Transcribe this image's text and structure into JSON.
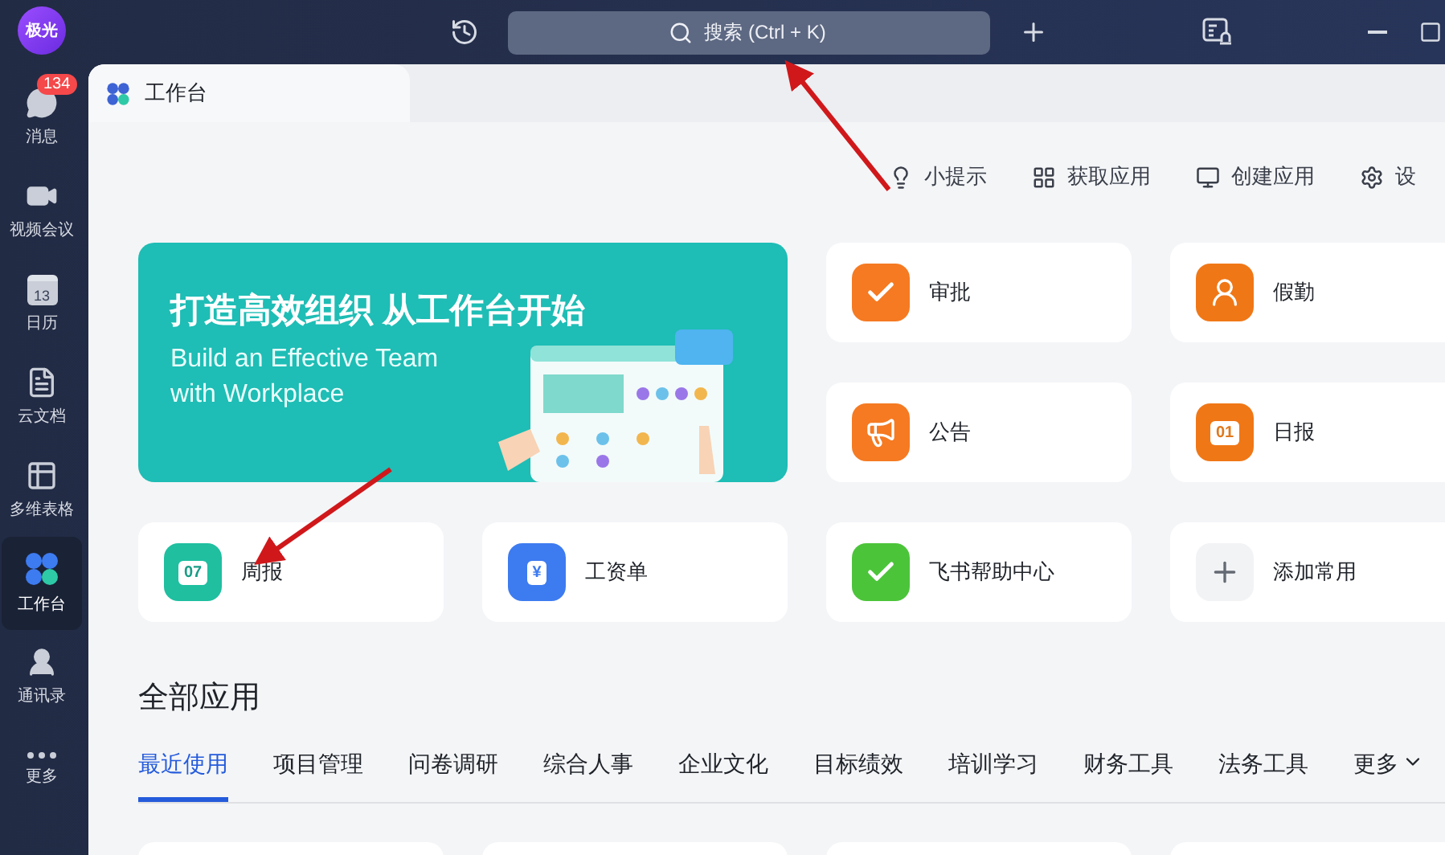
{
  "app": {
    "avatar": "极光"
  },
  "sidebar": {
    "items": [
      {
        "kind": "chat",
        "label": "消息",
        "badge": "134",
        "selected": false
      },
      {
        "kind": "video",
        "label": "视频会议",
        "selected": false
      },
      {
        "kind": "calendar",
        "label": "日历",
        "icon_text": "13",
        "selected": false
      },
      {
        "kind": "doc",
        "label": "云文档",
        "selected": false
      },
      {
        "kind": "table",
        "label": "多维表格",
        "selected": false
      },
      {
        "kind": "grid",
        "label": "工作台",
        "selected": true
      },
      {
        "kind": "contacts",
        "label": "通讯录",
        "selected": false
      },
      {
        "kind": "more",
        "label": "更多",
        "selected": false
      }
    ]
  },
  "topbar": {
    "search": {
      "placeholder": "搜索 (Ctrl + K)"
    }
  },
  "tab": {
    "title": "工作台"
  },
  "toolbar": [
    {
      "kind": "tip",
      "label": "小提示"
    },
    {
      "kind": "apps",
      "label": "获取应用"
    },
    {
      "kind": "create",
      "label": "创建应用"
    },
    {
      "kind": "settings",
      "label": "设"
    }
  ],
  "banner": {
    "title": "打造高效组织 从工作台开始",
    "subtitle_lines": [
      "Build an Effective Team",
      "with Workplace"
    ]
  },
  "shortcuts": [
    {
      "kind": "approval",
      "label": "审批"
    },
    {
      "kind": "attendance",
      "label": "假勤"
    },
    {
      "kind": "notice",
      "label": "公告"
    },
    {
      "kind": "daily",
      "label": "日报",
      "icon_text": "01"
    },
    {
      "kind": "weekly",
      "label": "周报",
      "icon_text": "07"
    },
    {
      "kind": "salary",
      "label": "工资单",
      "icon_text": "¥"
    },
    {
      "kind": "help",
      "label": "飞书帮助中心"
    },
    {
      "kind": "add",
      "label": "添加常用"
    }
  ],
  "all_apps": {
    "title": "全部应用",
    "tabs": [
      {
        "label": "最近使用",
        "selected": true
      },
      {
        "label": "项目管理",
        "selected": false
      },
      {
        "label": "问卷调研",
        "selected": false
      },
      {
        "label": "综合人事",
        "selected": false
      },
      {
        "label": "企业文化",
        "selected": false
      },
      {
        "label": "目标绩效",
        "selected": false
      },
      {
        "label": "培训学习",
        "selected": false
      },
      {
        "label": "财务工具",
        "selected": false
      },
      {
        "label": "法务工具",
        "selected": false
      }
    ],
    "more": "更多"
  }
}
